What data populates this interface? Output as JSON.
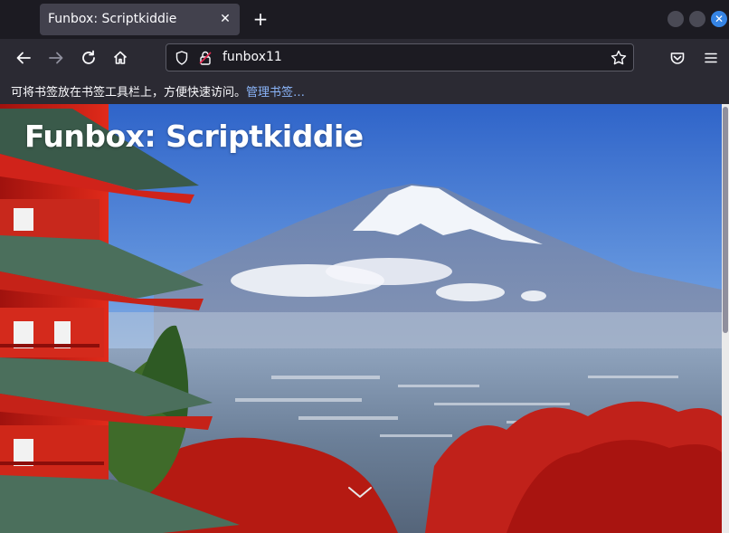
{
  "browser": {
    "tab": {
      "title": "Funbox: Scriptkiddie",
      "close_icon": "close-icon"
    },
    "new_tab_icon": "plus-icon",
    "window_controls": [
      "minimize",
      "maximize",
      "close"
    ],
    "accent_color": "#3584e4"
  },
  "navbar": {
    "url": "funbox11",
    "back_icon": "arrow-left-icon",
    "forward_icon": "arrow-right-icon",
    "reload_icon": "reload-icon",
    "home_icon": "home-icon",
    "star_icon": "star-icon",
    "pocket_icon": "pocket-icon",
    "menu_icon": "hamburger-menu-icon"
  },
  "bookmarks_bar": {
    "message": "可将书签放在书签工具栏上，方便快速访问。",
    "link": "管理书签…"
  },
  "page": {
    "hero_title": "Funbox: Scriptkiddie",
    "scroll_hint_icon": "chevron-down-icon"
  }
}
